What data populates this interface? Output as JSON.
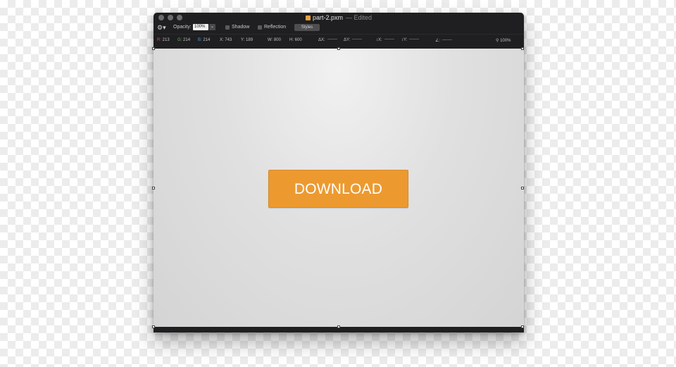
{
  "window": {
    "title": "part-2.pxm",
    "status": "— Edited"
  },
  "toolbar": {
    "opacity_label": "Opacity:",
    "opacity_value": "100%",
    "shadow_label": "Shadow",
    "reflection_label": "Reflection",
    "styles_label": "Styles"
  },
  "info_bar": {
    "r_label": "R:",
    "r_value": "213",
    "g_label": "G:",
    "g_value": "214",
    "b_label": "B:",
    "b_value": "214",
    "x_label": "X:",
    "x_value": "743",
    "y_label": "Y:",
    "y_value": "189",
    "w_label": "W:",
    "w_value": "800",
    "h_label": "H:",
    "h_value": "600",
    "dx_label": "ΔX:",
    "dy_label": "ΔY:",
    "ix_label": "↕X:",
    "iy_label": "↕Y:",
    "angle_label": "∠:",
    "zoom_value": "100%"
  },
  "canvas": {
    "button_label": "DOWNLOAD",
    "button_color": "#ec9a30"
  },
  "icons": {
    "gear": "gear-icon",
    "zoom": "magnifier-icon",
    "document": "pxm-document-icon"
  }
}
